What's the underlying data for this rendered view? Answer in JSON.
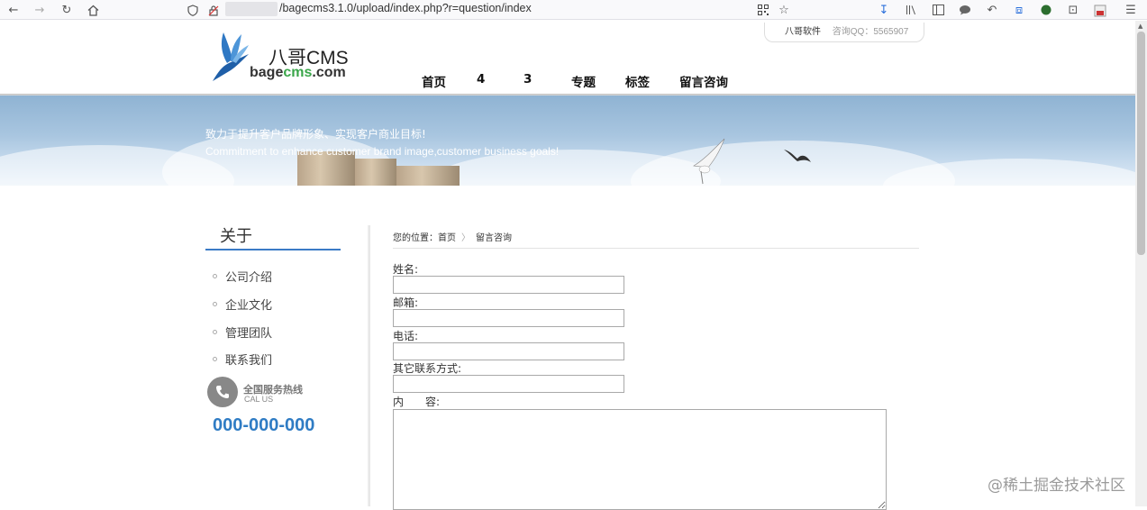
{
  "browser": {
    "url": "/bagecms3.1.0/upload/index.php?r=question/index"
  },
  "site": {
    "company": "八哥软件",
    "qq": "咨询QQ：5565907",
    "logo_title": "八哥CMS",
    "logo_domain_a": "bage",
    "logo_domain_b": "cms",
    "logo_domain_c": ".com",
    "nav": [
      "首页",
      "4",
      "3",
      "专题",
      "标签",
      "留言咨询"
    ],
    "slogan_cn": "致力于提升客户品牌形象、实现客户商业目标!",
    "slogan_en": "Commitment to enhance customer brand image,customer business goals!"
  },
  "sidebar": {
    "title": "关于",
    "items": [
      "公司介绍",
      "企业文化",
      "管理团队",
      "联系我们"
    ],
    "hotline_cn": "全国服务热线",
    "hotline_en": "CAL US",
    "hotline_number": "000-000-000"
  },
  "breadcrumb": {
    "prefix": "您的位置：",
    "home": "首页",
    "separator": "〉",
    "current": "留言咨询"
  },
  "form": {
    "name_label": "姓名:",
    "email_label": "邮箱:",
    "phone_label": "电话:",
    "other_label": "其它联系方式:",
    "content_label": "内　　容:",
    "name_value": "",
    "email_value": "",
    "phone_value": "",
    "other_value": "",
    "content_value": ""
  },
  "watermark": "@稀土掘金技术社区",
  "colors": {
    "accent_blue": "#2f7cc4",
    "logo_green": "#3aa64a"
  }
}
